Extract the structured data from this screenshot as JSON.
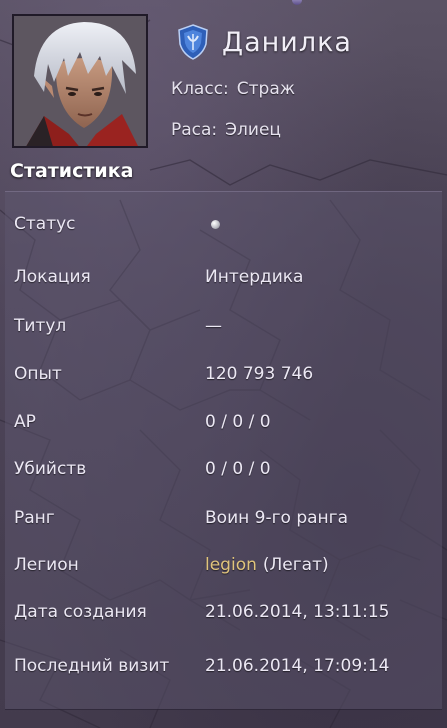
{
  "character": {
    "name": "Данилка",
    "class_label": "Класс:",
    "class_value": "Страж",
    "race_label": "Раса:",
    "race_value": "Элиец",
    "emblem_icon": "blue-shield-emblem-icon",
    "avatar": "character-portrait"
  },
  "stats": {
    "title": "Статистика",
    "status": {
      "label": "Статус",
      "icon": "offline-status-dot"
    },
    "location": {
      "label": "Локация",
      "value": "Интердика"
    },
    "title_row": {
      "label": "Титул",
      "value": "—"
    },
    "experience": {
      "label": "Опыт",
      "value": "120 793 746"
    },
    "ap": {
      "label": "АР",
      "value": "0 / 0 / 0"
    },
    "kills": {
      "label": "Убийств",
      "value": "0 / 0 / 0"
    },
    "rank": {
      "label": "Ранг",
      "value": "Воин 9-го ранга"
    },
    "legion": {
      "label": "Легион",
      "name": "legion",
      "role": "(Легат)"
    },
    "created": {
      "label": "Дата создания",
      "value": "21.06.2014, 13:11:15"
    },
    "last_visit": {
      "label": "Последний визит",
      "value": "21.06.2014, 17:09:14"
    }
  },
  "colors": {
    "background": "#4e4658",
    "legion_link": "#e0c47c",
    "text": "#ece8f4"
  }
}
